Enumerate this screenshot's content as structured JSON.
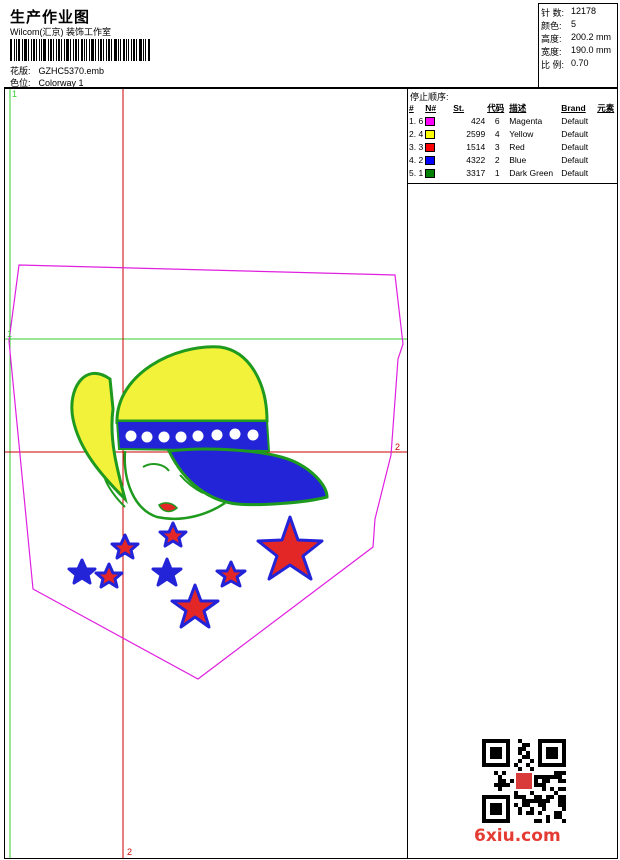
{
  "header": {
    "title": "生产作业图",
    "subtitle": "Wilcom(汇京) 装饰工作室",
    "design_label": "花版:",
    "design_value": "GZHC5370.emb",
    "colorway_label": "色位:",
    "colorway_value": "Colorway 1"
  },
  "stats": [
    {
      "label": "针 数:",
      "value": "12178"
    },
    {
      "label": "颜色:",
      "value": "5"
    },
    {
      "label": "高度:",
      "value": "200.2 mm"
    },
    {
      "label": "宽度:",
      "value": "190.0 mm"
    },
    {
      "label": "比 例:",
      "value": "0.70"
    }
  ],
  "stop_sequence": {
    "title": "停止顺序:",
    "columns": [
      "#",
      "N#",
      "St.",
      "代码",
      "描述",
      "Brand",
      "元素"
    ],
    "rows": [
      {
        "idx": "1. 6",
        "color": "#ff00ff",
        "st": "424",
        "code": "6",
        "desc": "Magenta",
        "brand": "Default"
      },
      {
        "idx": "2. 4",
        "color": "#ffff00",
        "st": "2599",
        "code": "4",
        "desc": "Yellow",
        "brand": "Default"
      },
      {
        "idx": "3. 3",
        "color": "#ff0000",
        "st": "1514",
        "code": "3",
        "desc": "Red",
        "brand": "Default"
      },
      {
        "idx": "4. 2",
        "color": "#0000ff",
        "st": "4322",
        "code": "2",
        "desc": "Blue",
        "brand": "Default"
      },
      {
        "idx": "5. 1",
        "color": "#008000",
        "st": "3317",
        "code": "1",
        "desc": "Dark Green",
        "brand": "Default"
      }
    ]
  },
  "guides": {
    "marker_1": "1",
    "marker_2": "2"
  },
  "colors": {
    "magenta": "#e020e0",
    "yellow": "#f2f23a",
    "red": "#e32626",
    "blue": "#2323d8",
    "green": "#1e9a1e",
    "guide_red": "#cc0000",
    "guide_green": "#33cc33"
  },
  "watermark": {
    "text": "6xiu.com"
  }
}
